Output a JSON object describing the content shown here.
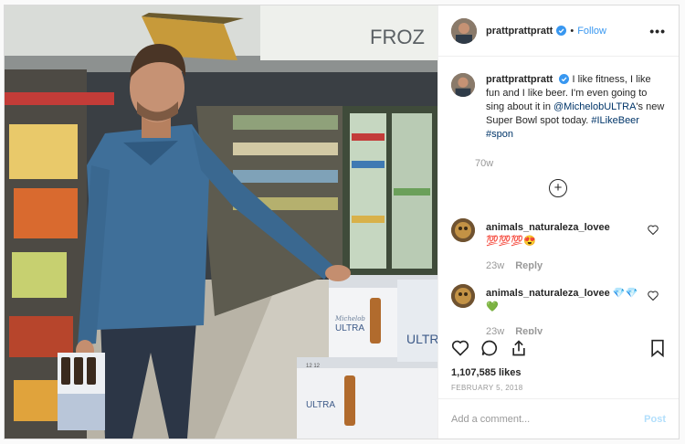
{
  "post": {
    "username": "prattprattpratt",
    "follow_label": "Follow",
    "more_label": "•••",
    "photo_sign_text": "FROZ",
    "bottle_brand": "ULTRA",
    "bottle_brand_script": "Michelob",
    "case_label": "12 12"
  },
  "caption": {
    "username": "prattprattpratt",
    "text_1": " I like fitness, I like fun and I like beer. I'm even going to sing about it in ",
    "mention": "@MichelobULTRA",
    "text_2": "'s new Super Bowl spot today. ",
    "hashtags": "#ILikeBeer #spon",
    "age": "70w"
  },
  "comments": [
    {
      "username": "animals_naturaleza_lovee",
      "emoji": "💯💯💯😍",
      "age": "23w",
      "reply_label": "Reply"
    },
    {
      "username": "animals_naturaleza_lovee",
      "emoji_inline": "💎💎",
      "emoji_next": "💚",
      "age": "23w",
      "reply_label": "Reply"
    }
  ],
  "stats": {
    "likes": "1,107,585 likes",
    "date": "FEBRUARY 5, 2018"
  },
  "add_comment": {
    "placeholder": "Add a comment...",
    "post_label": "Post"
  },
  "colors": {
    "link_blue": "#3897f0",
    "mention": "#003569",
    "muted": "#999999",
    "post_disabled": "#b2dffc"
  },
  "icons": [
    "verified-badge-icon",
    "heart-icon",
    "comment-icon",
    "share-icon",
    "bookmark-icon",
    "add-circle-icon",
    "more-icon"
  ]
}
